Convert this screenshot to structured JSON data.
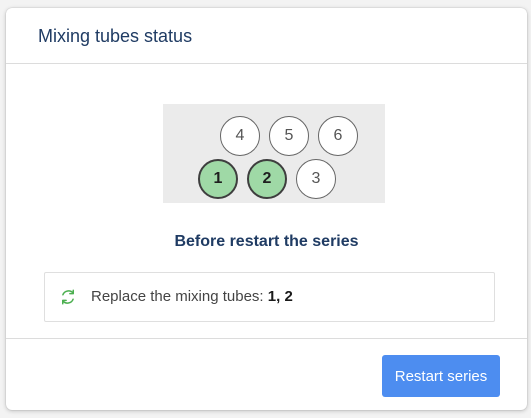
{
  "dialog": {
    "title": "Mixing tubes status",
    "caption": "Before restart the series"
  },
  "tubes": [
    {
      "number": "4",
      "state": "ok"
    },
    {
      "number": "5",
      "state": "ok"
    },
    {
      "number": "6",
      "state": "ok"
    },
    {
      "number": "1",
      "state": "replace"
    },
    {
      "number": "2",
      "state": "replace"
    },
    {
      "number": "3",
      "state": "ok"
    }
  ],
  "info": {
    "icon": "refresh-icon",
    "label": "Replace the mixing tubes: ",
    "value": "1, 2"
  },
  "footer": {
    "restart_label": "Restart series"
  },
  "colors": {
    "title": "#1f3b63",
    "tube_replace_fill": "#9fd9a6",
    "refresh_icon": "#4caf50",
    "button": "#4d8df0"
  }
}
